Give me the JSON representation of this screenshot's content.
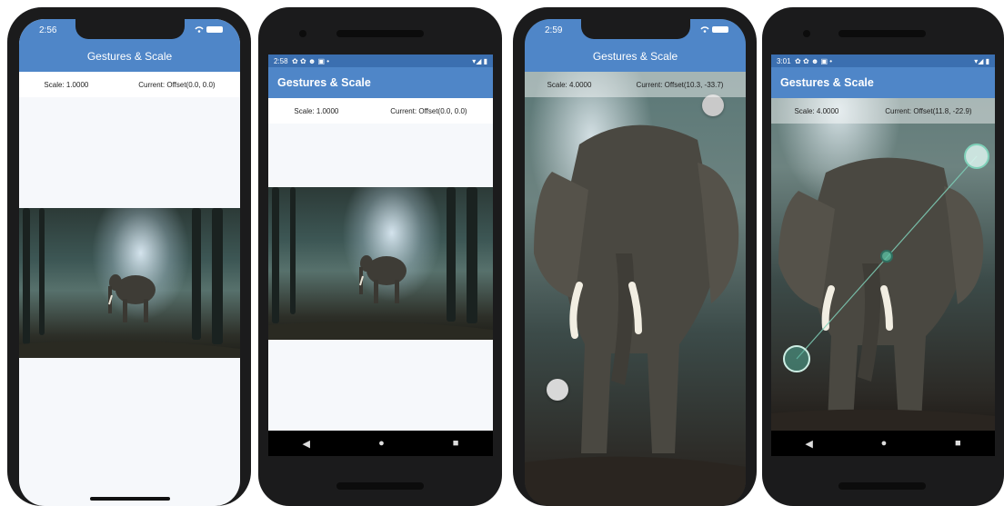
{
  "screens": [
    {
      "status_time": "2:56",
      "title": "Gestures & Scale",
      "scale_text": "Scale: 1.0000",
      "offset_text": "Current: Offset(0.0, 0.0)"
    },
    {
      "status_time": "2:58",
      "title": "Gestures & Scale",
      "scale_text": "Scale: 1.0000",
      "offset_text": "Current: Offset(0.0, 0.0)"
    },
    {
      "status_time": "2:59",
      "title": "Gestures & Scale",
      "scale_text": "Scale: 4.0000",
      "offset_text": "Current: Offset(10.3, -33.7)"
    },
    {
      "status_time": "3:01",
      "title": "Gestures & Scale",
      "scale_text": "Scale: 4.0000",
      "offset_text": "Current: Offset(11.8, -22.9)"
    }
  ],
  "icons": {
    "ios_status": "wifi-battery-icons",
    "android_status": "settings-notification-icons",
    "android_signal": "wifi-signal-battery-icons",
    "nav_back": "◀",
    "nav_home": "●",
    "nav_recent": "■"
  },
  "colors": {
    "appbar": "#4f86c8",
    "android_statusbar": "#3b6fb0",
    "touch_gray": "#c9c9c9",
    "touch_teal": "#7fd1b9"
  }
}
